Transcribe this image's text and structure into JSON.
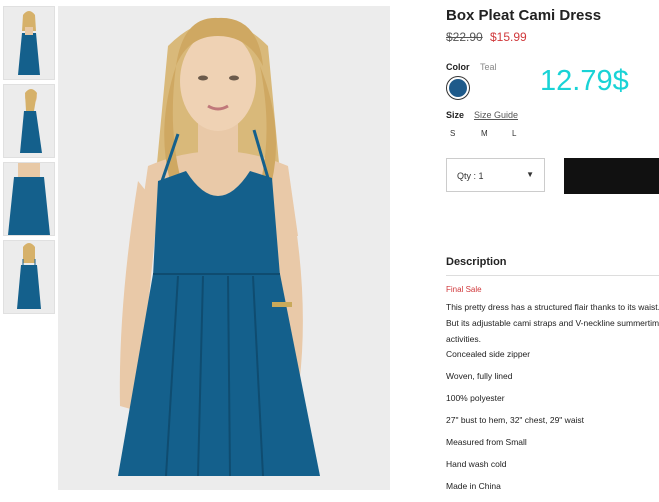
{
  "product": {
    "title": "Box Pleat Cami Dress",
    "price_old": "$22.90",
    "price_new": "$15.99",
    "overlay_price": "12.79$"
  },
  "color": {
    "label": "Color",
    "value": "Teal",
    "swatch_color": "#1e5a8a"
  },
  "size": {
    "label": "Size",
    "guide_label": "Size Guide",
    "options": [
      "S",
      "M",
      "L"
    ]
  },
  "quantity": {
    "label": "Qty : 1"
  },
  "description": {
    "heading": "Description",
    "final_sale": "Final Sale",
    "text": "This pretty dress has a structured flair thanks to its waist. But its adjustable cami straps and V-neckline summertime activities.",
    "details": [
      "Concealed side zipper",
      "Woven, fully lined",
      "100% polyester",
      "27\" bust to hem, 32\" chest, 29\" waist",
      "Measured from Small",
      "Hand wash cold",
      "Made in China"
    ]
  },
  "colors": {
    "dress": "#14608c",
    "price_accent": "#d0383b",
    "overlay": "#19d3d6"
  }
}
